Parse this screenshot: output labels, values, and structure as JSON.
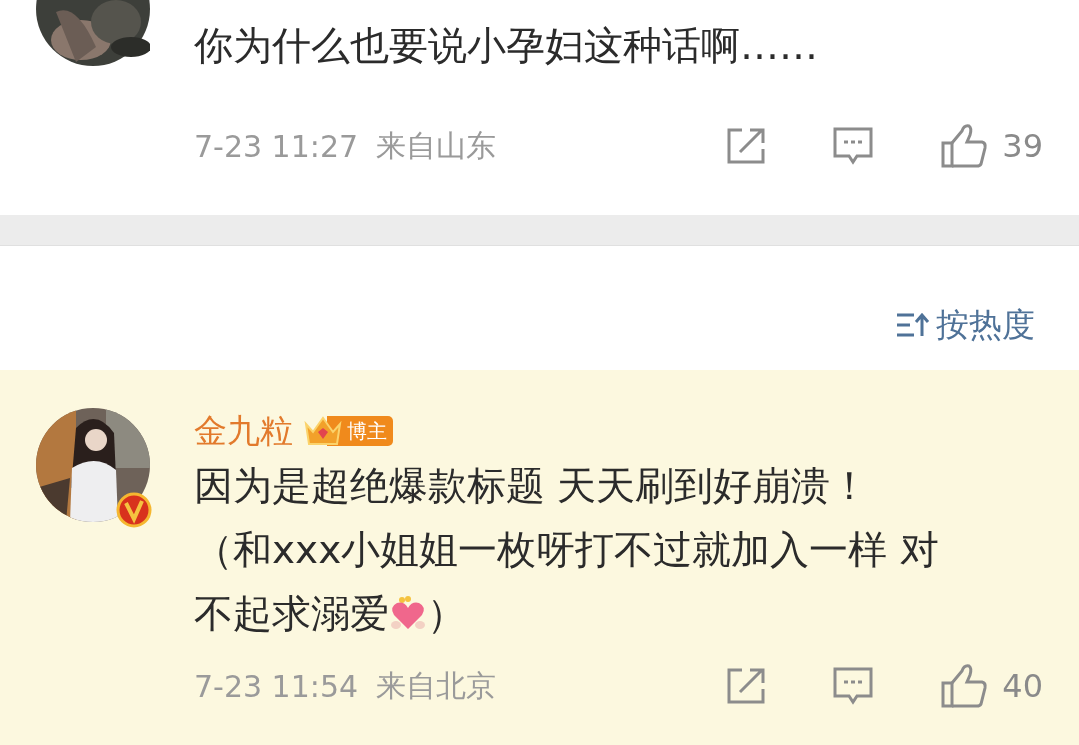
{
  "comments": [
    {
      "avatar": {
        "kind": "picture"
      },
      "verified": false,
      "lines": [
        [
          {
            "kind": "text",
            "text": "你为什么也要说小孕妇这种话啊……"
          }
        ]
      ],
      "time": "7-23 11:27",
      "location": "来自山东",
      "likes": "39",
      "highlighted": false
    },
    {
      "avatar": {
        "kind": "picture"
      },
      "author": "金九粒",
      "badge": "博主",
      "verified": true,
      "lines": [
        [
          {
            "kind": "text",
            "text": "因为是超绝爆款标题 天天刷到好崩溃！"
          }
        ],
        [
          {
            "kind": "text",
            "text": "（和xxx小姐姐一枚呀打不过就加入一样 对"
          }
        ],
        [
          {
            "kind": "text",
            "text": "不起求溺爱"
          },
          {
            "kind": "emoji"
          },
          {
            "kind": "text",
            "text": "）"
          }
        ]
      ],
      "time": "7-23 11:54",
      "location": "来自北京",
      "likes": "40",
      "highlighted": true
    }
  ],
  "sort": {
    "label": "按热度"
  }
}
